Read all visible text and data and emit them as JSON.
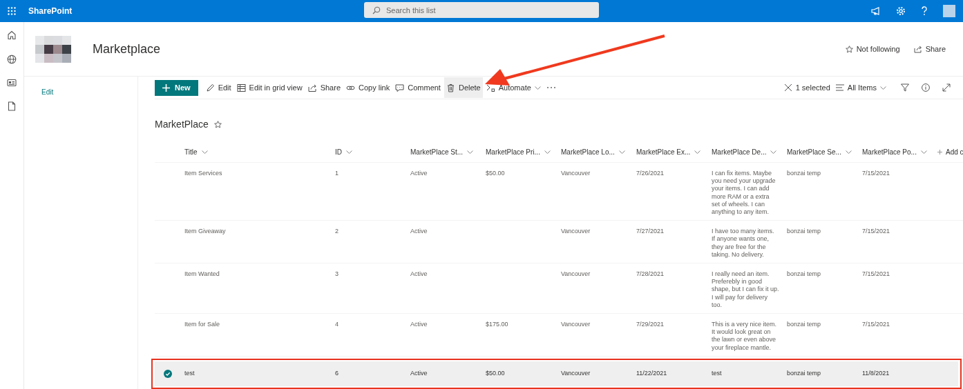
{
  "app": {
    "name": "SharePoint"
  },
  "search": {
    "placeholder": "Search this list"
  },
  "site": {
    "title": "Marketplace",
    "follow": "Not following",
    "share": "Share"
  },
  "nav": {
    "edit": "Edit"
  },
  "commands": [
    {
      "kind": "new",
      "label": "New"
    },
    {
      "kind": "edit",
      "label": "Edit"
    },
    {
      "kind": "grid",
      "label": "Edit in grid view"
    },
    {
      "kind": "share",
      "label": "Share"
    },
    {
      "kind": "link",
      "label": "Copy link"
    },
    {
      "kind": "comment",
      "label": "Comment"
    },
    {
      "kind": "delete",
      "label": "Delete"
    },
    {
      "kind": "automate",
      "label": "Automate"
    },
    {
      "kind": "more"
    }
  ],
  "selection": {
    "count": "1 selected"
  },
  "view": {
    "label": "All Items"
  },
  "list": {
    "title": "MarketPlace"
  },
  "table": {
    "columns": [
      "Title",
      "ID",
      "MarketPlace St...",
      "MarketPlace Pri...",
      "MarketPlace Lo...",
      "MarketPlace Ex...",
      "MarketPlace De...",
      "MarketPlace Se...",
      "MarketPlace Po..."
    ],
    "add_column": "Add c",
    "rows": [
      {
        "selected": false,
        "cells": [
          "Item Services",
          "1",
          "Active",
          "$50.00",
          "Vancouver",
          "7/26/2021",
          "I can fix items. Maybe you need your upgrade your items. I can add more RAM or a extra set of wheels. I can anything to any item.",
          "bonzai temp",
          "7/15/2021"
        ]
      },
      {
        "selected": false,
        "cells": [
          "Item Giveaway",
          "2",
          "Active",
          "",
          "Vancouver",
          "7/27/2021",
          "I have too many items. If anyone wants one, they are free for the taking. No delivery.",
          "bonzai temp",
          "7/15/2021"
        ]
      },
      {
        "selected": false,
        "cells": [
          "Item Wanted",
          "3",
          "Active",
          "",
          "Vancouver",
          "7/28/2021",
          "I really need an item. Preferebly in good shape, but I can fix it up. I will pay for delivery too.",
          "bonzai temp",
          "7/15/2021"
        ]
      },
      {
        "selected": false,
        "cells": [
          "Item for Sale",
          "4",
          "Active",
          "$175.00",
          "Vancouver",
          "7/29/2021",
          "This is a very nice item. It would look great on the lawn or even above your fireplace mantle.",
          "bonzai temp",
          "7/15/2021"
        ]
      },
      {
        "selected": true,
        "cells": [
          "test",
          "6",
          "Active",
          "$50.00",
          "Vancouver",
          "11/22/2021",
          "test",
          "bonzai temp",
          "11/8/2021"
        ]
      }
    ]
  }
}
